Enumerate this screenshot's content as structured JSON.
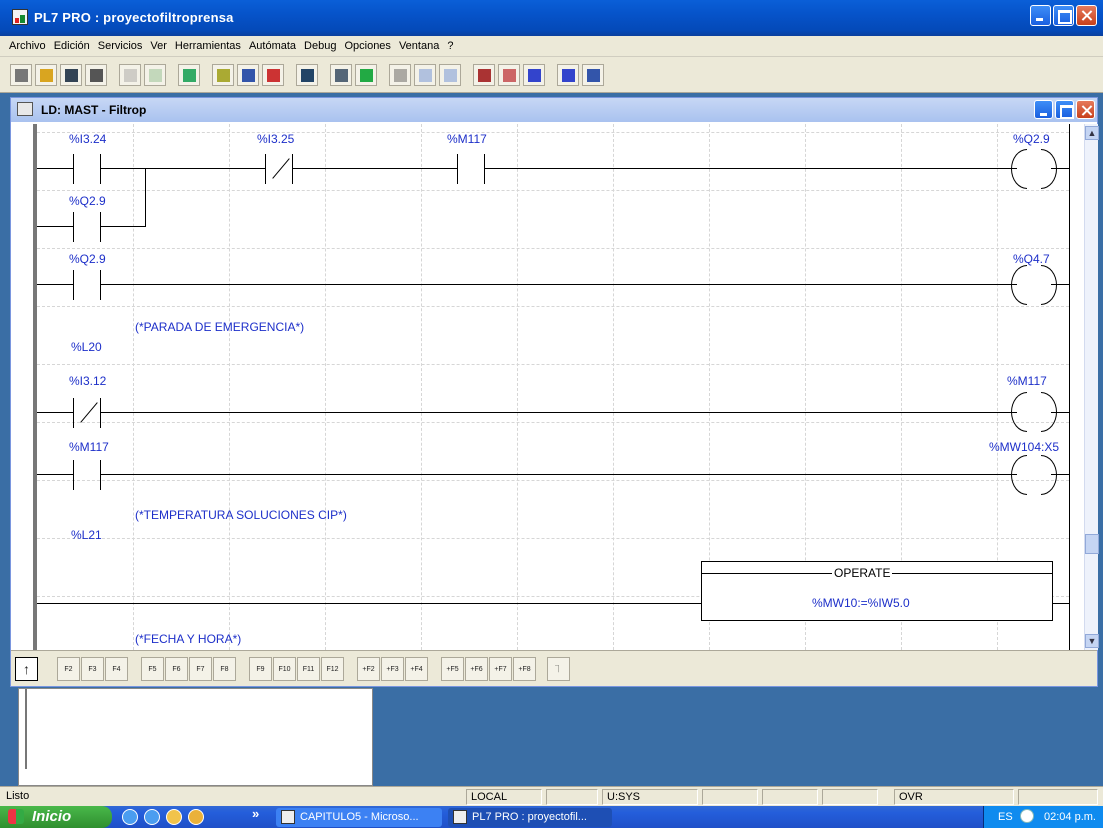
{
  "app": {
    "title": "PL7 PRO : proyectofiltroprensa"
  },
  "menu": [
    "Archivo",
    "Edición",
    "Servicios",
    "Ver",
    "Herramientas",
    "Autómata",
    "Debug",
    "Opciones",
    "Ventana",
    "?"
  ],
  "toolbar_icons": [
    "new-icon",
    "open-icon",
    "save-icon",
    "print-icon",
    "sep",
    "undo-icon",
    "validate-icon",
    "sep",
    "transfer-icon",
    "sep",
    "ld-editor-icon",
    "find-icon",
    "variables-icon",
    "sep",
    "io-icon",
    "sep",
    "screen-icon",
    "memory-icon",
    "sep",
    "run-icon",
    "stop-icon",
    "init-icon",
    "sep",
    "tile-icon",
    "cascade-icon",
    "window-icon",
    "sep",
    "help-icon",
    "context-help-icon"
  ],
  "child_window": {
    "title": "LD: MAST - Filtrop"
  },
  "ladder": {
    "rung1": {
      "contact1": "%I3.24",
      "contact2": "%I3.25",
      "contact3": "%M117",
      "coil": "%Q2.9",
      "branch": "%Q2.9"
    },
    "rung2": {
      "contact1": "%Q2.9",
      "coil": "%Q4.7"
    },
    "label1": {
      "name": "%L20",
      "comment": "(*PARADA DE EMERGENCIA*)"
    },
    "rung3": {
      "contact1": "%I3.12",
      "coil": "%M117"
    },
    "rung4": {
      "contact1": "%M117",
      "coil": "%MW104:X5"
    },
    "label2": {
      "name": "%L21",
      "comment": "(*TEMPERATURA SOLUCIONES CIP*)"
    },
    "operate": {
      "header": "OPERATE",
      "expr": "%MW10:=%IW5.0"
    },
    "comment3": "(*FECHA Y HORA*)"
  },
  "palette": [
    {
      "icon": "up-arrow-icon",
      "label": "↑"
    },
    {
      "icon": "no-contact-icon",
      "label": "F2"
    },
    {
      "icon": "nc-contact-icon",
      "label": "F3"
    },
    {
      "icon": "p-contact-icon",
      "label": "F4"
    },
    {
      "icon": "n-contact-icon",
      "label": "F5"
    },
    {
      "icon": "hline-icon",
      "label": "F6"
    },
    {
      "icon": "vline-icon",
      "label": "F7"
    },
    {
      "icon": "fill-line-icon",
      "label": "F8"
    },
    {
      "icon": "coil-icon",
      "label": "F9"
    },
    {
      "icon": "neg-coil-icon",
      "label": "F10"
    },
    {
      "icon": "set-coil-icon",
      "label": "F11"
    },
    {
      "icon": "reset-coil-icon",
      "label": "F12"
    },
    {
      "icon": "jump-icon",
      "label": "+F2"
    },
    {
      "icon": "oper-icon",
      "label": "+F3"
    },
    {
      "icon": "comp-h-icon",
      "label": "+F4"
    },
    {
      "icon": "comp-v-icon",
      "label": "+F5"
    },
    {
      "icon": "call-icon",
      "label": "+F6"
    },
    {
      "icon": "fb-icon",
      "label": "+F7"
    },
    {
      "icon": "func-icon",
      "label": "+F8"
    },
    {
      "icon": "return-icon",
      "label": "⏋"
    }
  ],
  "status": {
    "state": "Listo",
    "mode": "LOCAL",
    "user": "U:SYS",
    "ovr": "OVR"
  },
  "taskbar": {
    "start": "Inicio",
    "chevron": "»",
    "tasks": [
      "CAPITULO5 - Microso...",
      "PL7 PRO : proyectofil..."
    ],
    "lang": "ES",
    "clock": "02:04 p.m."
  }
}
